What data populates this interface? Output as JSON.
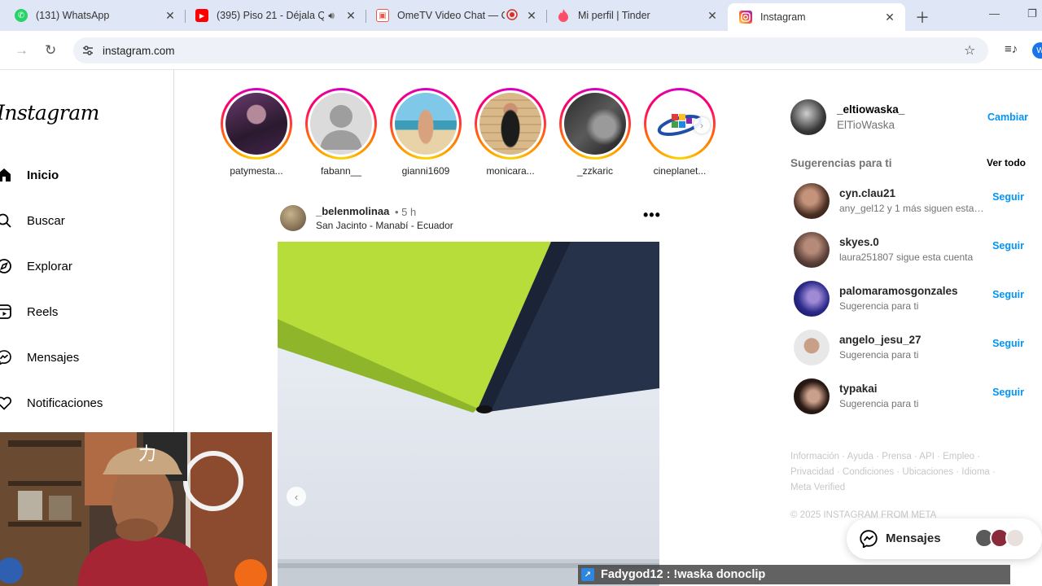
{
  "browser": {
    "tabs": [
      {
        "title": "(131) WhatsApp",
        "color": "#25d366",
        "glyph": "✆"
      },
      {
        "title": "(395) Piso 21 - Déjala Qu",
        "color": "#ff0000",
        "glyph": "▶"
      },
      {
        "title": "OmeTV Video Chat — O",
        "color": "#e55a4e",
        "glyph": "▣"
      },
      {
        "title": "Mi perfil | Tinder",
        "color": "#fd5068",
        "glyph": "❦"
      },
      {
        "title": "Instagram",
        "color": "#d6249f",
        "glyph": "◎"
      }
    ],
    "url": "instagram.com"
  },
  "sidebar": {
    "logo": "Instagram",
    "items": [
      {
        "label": "Inicio",
        "icon": "home-icon"
      },
      {
        "label": "Buscar",
        "icon": "search-icon"
      },
      {
        "label": "Explorar",
        "icon": "compass-icon"
      },
      {
        "label": "Reels",
        "icon": "reels-icon"
      },
      {
        "label": "Mensajes",
        "icon": "messenger-icon"
      },
      {
        "label": "Notificaciones",
        "icon": "heart-icon"
      }
    ]
  },
  "stories": [
    {
      "name": "patymesta..."
    },
    {
      "name": "fabann__"
    },
    {
      "name": "gianni1609"
    },
    {
      "name": "monicara..."
    },
    {
      "name": "_zzkaric"
    },
    {
      "name": "cineplanet..."
    }
  ],
  "post": {
    "username": "_belenmolinaa",
    "time": "• 5 h",
    "location": "San Jacinto - Manabí - Ecuador"
  },
  "account": {
    "username": "_eltiowaska_",
    "name": "ElTioWaska",
    "switch_label": "Cambiar"
  },
  "suggestions": {
    "title": "Sugerencias para ti",
    "see_all": "Ver todo",
    "follow_label": "Seguir",
    "items": [
      {
        "username": "cyn.clau21",
        "subtitle": "any_gel12 y 1 más siguen esta c..."
      },
      {
        "username": "skyes.0",
        "subtitle": "laura251807 sigue esta cuenta"
      },
      {
        "username": "palomaramosgonzales",
        "subtitle": "Sugerencia para ti"
      },
      {
        "username": "angelo_jesu_27",
        "subtitle": "Sugerencia para ti"
      },
      {
        "username": "typakai",
        "subtitle": "Sugerencia para ti"
      }
    ]
  },
  "footer": {
    "links": "Información · Ayuda · Prensa · API · Empleo · Privacidad · Condiciones · Ubicaciones · Idioma · Meta Verified",
    "copyright": "© 2025 INSTAGRAM FROM META"
  },
  "messages_pill": {
    "label": "Mensajes"
  },
  "stream_chat": {
    "text": "Fadygod12 : !waska donoclip"
  }
}
